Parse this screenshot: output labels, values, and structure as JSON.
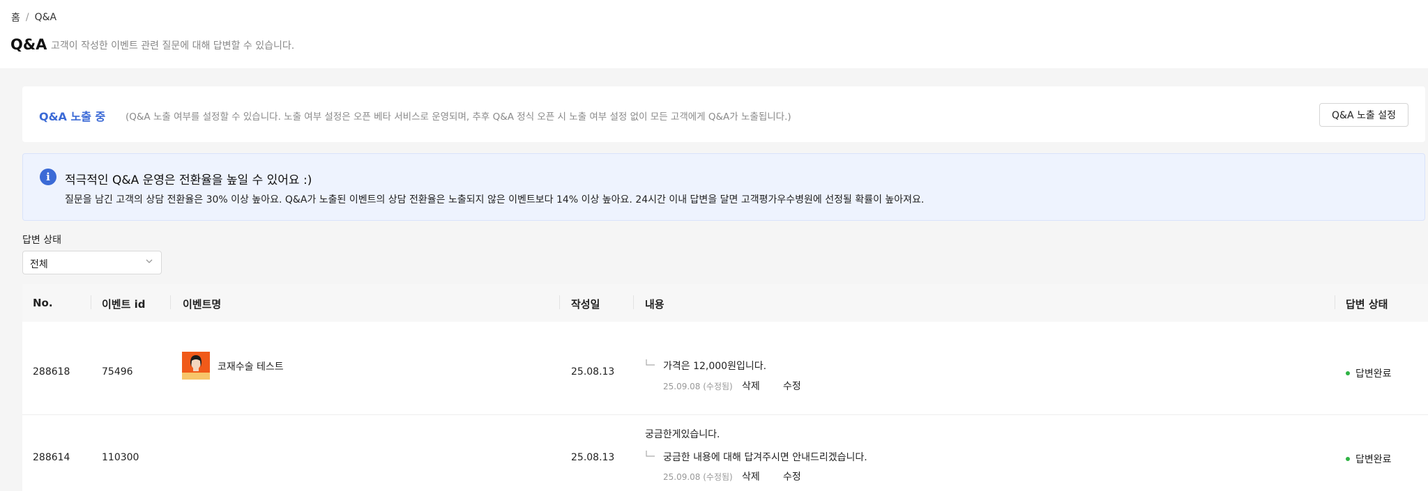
{
  "breadcrumb": {
    "home": "홈",
    "separator": "/",
    "current": "Q&A"
  },
  "page": {
    "title": "Q&A",
    "description": "고객이 작성한 이벤트 관련 질문에 대해 답변할 수 있습니다."
  },
  "exposure": {
    "status": "Q&A 노출 중",
    "note": "(Q&A 노출 여부를 설정할 수 있습니다. 노출 여부 설정은 오픈 베타 서비스로 운영되며, 추후 Q&A 정식 오픈 시 노출 여부 설정 없이 모든 고객에게 Q&A가 노출됩니다.)",
    "button_label": "Q&A 노출 설정"
  },
  "info": {
    "icon": "info-icon",
    "icon_glyph": "i",
    "title": "적극적인 Q&A 운영은 전환율을 높일 수 있어요 :)",
    "body": "질문을 남긴 고객의 상담 전환율은 30% 이상 높아요. Q&A가 노출된 이벤트의 상담 전환율은 노출되지 않은 이벤트보다 14% 이상 높아요. 24시간 이내 답변을 달면 고객평가우수병원에 선정될 확률이 높아져요."
  },
  "filter": {
    "label": "답변 상태",
    "selected": "전체"
  },
  "table": {
    "columns": [
      "No.",
      "이벤트 id",
      "이벤트명",
      "작성일",
      "내용",
      "답변 상태"
    ],
    "rows": [
      {
        "no": "288618",
        "event_id": "75496",
        "event_name": "코재수술 테스트",
        "date": "25.08.13",
        "question": "",
        "answer": "가격은 12,000원입니다.",
        "answer_meta": "25.09.08 (수정됨)",
        "delete_label": "삭제",
        "edit_label": "수정",
        "status": "답변완료",
        "status_color": "#2fb344"
      },
      {
        "no": "288614",
        "event_id": "110300",
        "event_name": "",
        "date": "25.08.13",
        "question": "궁금한게있습니다.",
        "answer": "궁금한 내용에 대해 답겨주시면 안내드리겠습니다.",
        "answer_meta": "25.09.08 (수정됨)",
        "delete_label": "삭제",
        "edit_label": "수정",
        "status": "답변완료",
        "status_color": "#2fb344"
      }
    ]
  }
}
